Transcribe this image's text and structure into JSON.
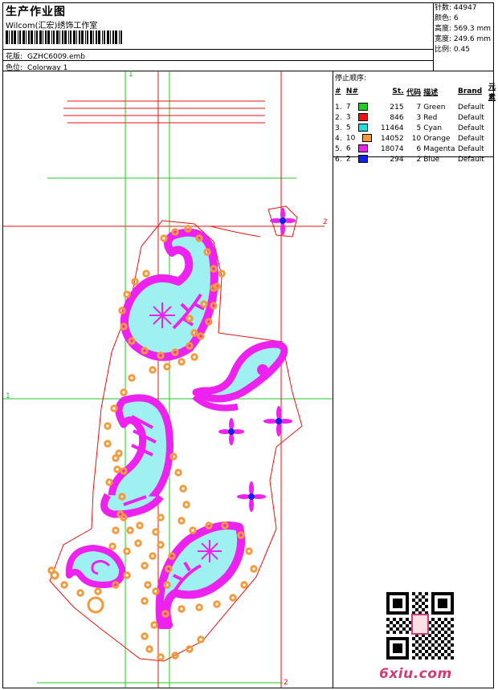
{
  "header": {
    "title": "生产作业图",
    "company": "Wilcom(汇宏)绣饰工作室",
    "file_label": "花版:",
    "file_name": "GZHC6009.emb",
    "colorway_label": "色位:",
    "colorway_name": "Colorway 1"
  },
  "stats": {
    "stitches": "针数: 44947",
    "colors": "颜色: 6",
    "height": "高度: 569.3 mm",
    "width": "宽度: 249.6 mm",
    "scale": "比例: 0.45"
  },
  "sequence": {
    "heading": "停止顺序:",
    "columns": [
      "#",
      "N#",
      "St.",
      "代码",
      "描述",
      "Brand",
      "元素"
    ],
    "rows": [
      {
        "idx": "1.",
        "n": "7",
        "color": "#22cc22",
        "st": "215",
        "code": "7",
        "desc": "Green",
        "brand": "Default"
      },
      {
        "idx": "2.",
        "n": "3",
        "color": "#ee1111",
        "st": "846",
        "code": "3",
        "desc": "Red",
        "brand": "Default"
      },
      {
        "idx": "3.",
        "n": "5",
        "color": "#22dddd",
        "st": "11464",
        "code": "5",
        "desc": "Cyan",
        "brand": "Default"
      },
      {
        "idx": "4.",
        "n": "10",
        "color": "#f59a3a",
        "st": "14052",
        "code": "10",
        "desc": "Orange",
        "brand": "Default"
      },
      {
        "idx": "5.",
        "n": "6",
        "color": "#ee22ee",
        "st": "18074",
        "code": "6",
        "desc": "Magenta",
        "brand": "Default"
      },
      {
        "idx": "6.",
        "n": "2",
        "color": "#1122ee",
        "st": "294",
        "code": "2",
        "desc": "Blue",
        "brand": "Default"
      }
    ]
  },
  "axes": {
    "top_1": "1",
    "right_2": "2",
    "left_1": "1",
    "bottom_2": "2"
  },
  "palette": {
    "green": "#22cc22",
    "red": "#ee1111",
    "cyan": "#9ff0f0",
    "orange": "#f59a3a",
    "magenta": "#ee22ee",
    "blue": "#1122ee"
  },
  "watermark": "6xiu.com"
}
